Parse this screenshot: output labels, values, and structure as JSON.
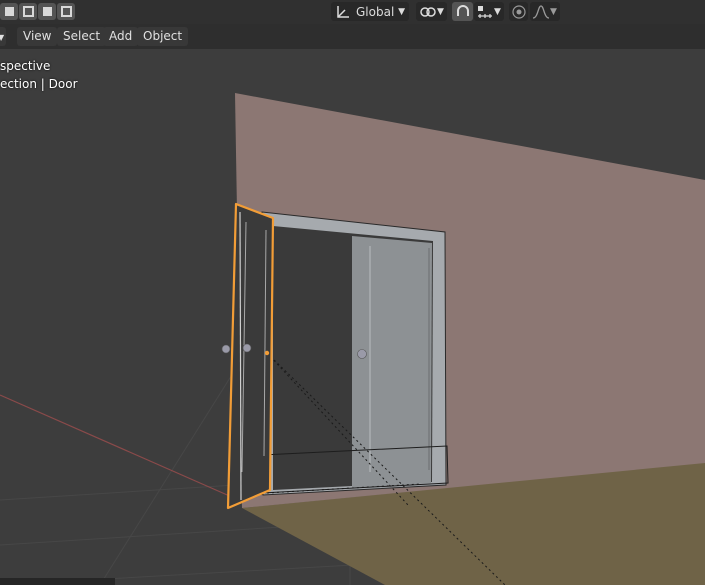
{
  "header": {
    "select_mode_icons": [
      "select-new-icon",
      "select-extend-icon",
      "select-subtract-icon",
      "select-invert-icon"
    ],
    "transform_orientation": "Global",
    "pivot_icon": "pivot-link-icon",
    "snap_icon": "snap-magnet-icon",
    "snap_target_icon": "snap-increment-icon",
    "proportional_edit_icon": "proportional-edit-icon",
    "falloff_icon": "falloff-curve-icon"
  },
  "menubar": {
    "items": [
      "View",
      "Select",
      "Add",
      "Object"
    ]
  },
  "viewport": {
    "view_label": "spective",
    "collection_label": "ection | Door"
  },
  "colors": {
    "background": "#3d3d3d",
    "wall": "#8c7773",
    "floor": "#6f6347",
    "selection_outline": "#f29d37",
    "header": "#303030"
  }
}
